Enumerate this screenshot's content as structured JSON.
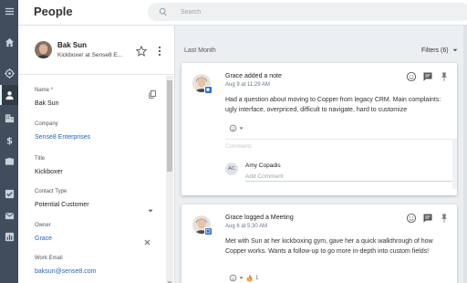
{
  "header": {
    "title": "People",
    "search_placeholder": "Search"
  },
  "nav": {
    "icons": [
      "menu-icon",
      "home-icon",
      "target-icon",
      "person-icon",
      "building-icon",
      "dollar-icon",
      "briefcase-icon",
      "checkbox-icon",
      "mail-icon",
      "chart-icon"
    ],
    "active": "person-icon"
  },
  "contact": {
    "name": "Bak Sun",
    "subtitle": "Kickboxer at Sense8 E..."
  },
  "fields": [
    {
      "label": "Name",
      "required_mark": "*",
      "value": "Bak Sun"
    },
    {
      "label": "Company",
      "value": "Sense8 Enterprises"
    },
    {
      "label": "Title",
      "value": "Kickboxer"
    },
    {
      "label": "Contact Type",
      "value": "Potential Customer"
    },
    {
      "label": "Owner",
      "value": "Grace"
    },
    {
      "label": "Work Email",
      "value": "baksun@sense8.com"
    }
  ],
  "feed": {
    "heading": "Last Month",
    "filters_label": "Filters (6)",
    "cards": [
      {
        "title": "Grace added a note",
        "date": "Aug 9 at 11:29 AM",
        "body": "Had a question about moving to Copper from legacy CRM. Main complaints: ugly interface, overpriced, difficult to navigate, hard to customize",
        "comments_label": "Comments",
        "commenter_initials": "AC",
        "commenter_name": "Amy Copadis",
        "add_comment_placeholder": "Add Comment"
      },
      {
        "title": "Grace logged a Meeting",
        "date": "Aug 6 at 5:30 AM",
        "body": "Met with Sun at her kickboxing gym, gave her a quick walkthrough of how Copper works. Wants a follow-up to go more in-depth into custom fields!",
        "reaction_count": "1"
      }
    ]
  },
  "colors": {
    "nav_bg": "#3f4d5c",
    "link": "#2a63b6",
    "badge": "#2b6bd6"
  }
}
